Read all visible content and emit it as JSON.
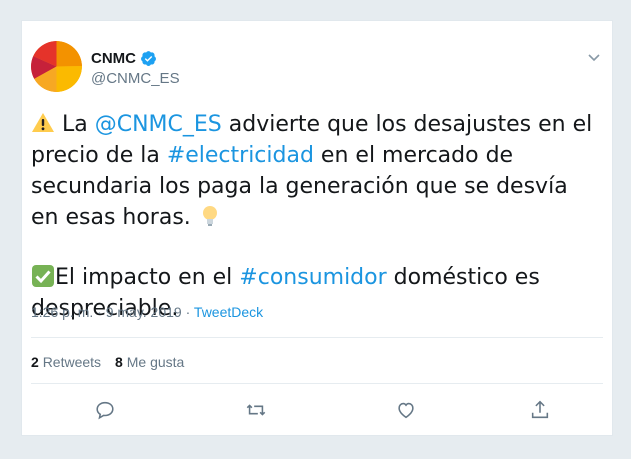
{
  "account": {
    "display_name": "CNMC",
    "handle": "@CNMC_ES",
    "verified_icon": "verified-badge-icon"
  },
  "tweet": {
    "p1_prefix": " La ",
    "p1_mention": "@CNMC_ES",
    "p1_mid1": " advierte que los desajustes en el precio de la ",
    "p1_hashtag": "#electricidad",
    "p1_mid2": " en el mercado de secundaria los paga la generación que se desvía en esas horas. ",
    "p2_prefix": "El impacto en el ",
    "p2_hashtag": "#consumidor",
    "p2_suffix": " doméstico es despreciable."
  },
  "meta": {
    "timestamp": "1:26 p. m. · 9 may. 2019",
    "separator": " · ",
    "source": "TweetDeck"
  },
  "stats": {
    "retweets_count": "2",
    "retweets_label": "Retweets",
    "likes_count": "8",
    "likes_label": "Me gusta"
  },
  "colors": {
    "link": "#1b95e0",
    "text": "#14171a",
    "muted": "#657786",
    "verified": "#1da1f2"
  },
  "icons": {
    "warning": "warning-icon",
    "bulb": "light-bulb-icon",
    "check": "check-mark-icon",
    "reply": "reply-icon",
    "retweet": "retweet-icon",
    "like": "like-icon",
    "share": "share-icon",
    "menu": "chevron-down-icon"
  }
}
